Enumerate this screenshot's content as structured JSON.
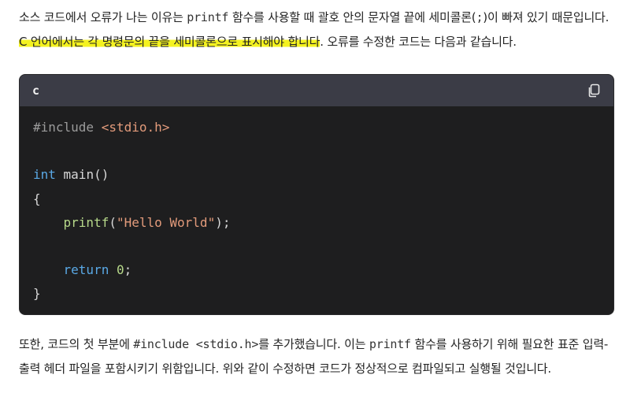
{
  "para1": {
    "s1": "소스 코드에서 오류가 나는 이유는 ",
    "c1": "printf",
    "s2": " 함수를 사용할 때 괄호 안의 문자열 끝에 세미콜론(",
    "c2": ";",
    "s3": ")이 빠져 있기 때문입니다. ",
    "highlight": "C 언어에서는 각 명령문의 끝을 세미콜론으로 표시해야 합니다",
    "s4": ". 오류를 수정한 코드는 다음과 같습니다."
  },
  "code_block": {
    "language": "c",
    "copy_icon": "copy-icon",
    "lines": {
      "l1_directive": "#include ",
      "l1_header": "<stdio.h>",
      "l3_kw": "int",
      "l3_rest": " main()",
      "l4": "{",
      "l5_indent": "    ",
      "l5_fn": "printf",
      "l5_open": "(",
      "l5_str": "\"Hello World\"",
      "l5_close": ");",
      "l7_indent": "    ",
      "l7_kw": "return",
      "l7_sp": " ",
      "l7_num": "0",
      "l7_end": ";",
      "l8": "}"
    },
    "colors": {
      "background": "#1e1e1f",
      "header": "#3b3c46",
      "keyword": "#5aa9e6",
      "string": "#e39b7b",
      "function": "#b7d98a",
      "preprocessor": "#9b9b9b"
    }
  },
  "para2": {
    "s1": "또한, 코드의 첫 부분에 ",
    "c1": "#include <stdio.h>",
    "s2": "를 추가했습니다. 이는 ",
    "c2": "printf",
    "s3": " 함수를 사용하기 위해 필요한 표준 입력-출력 헤더 파일을 포함시키기 위함입니다. 위와 같이 수정하면 코드가 정상적으로 컴파일되고 실행될 것입니다."
  },
  "highlight_color": "#f4f220"
}
